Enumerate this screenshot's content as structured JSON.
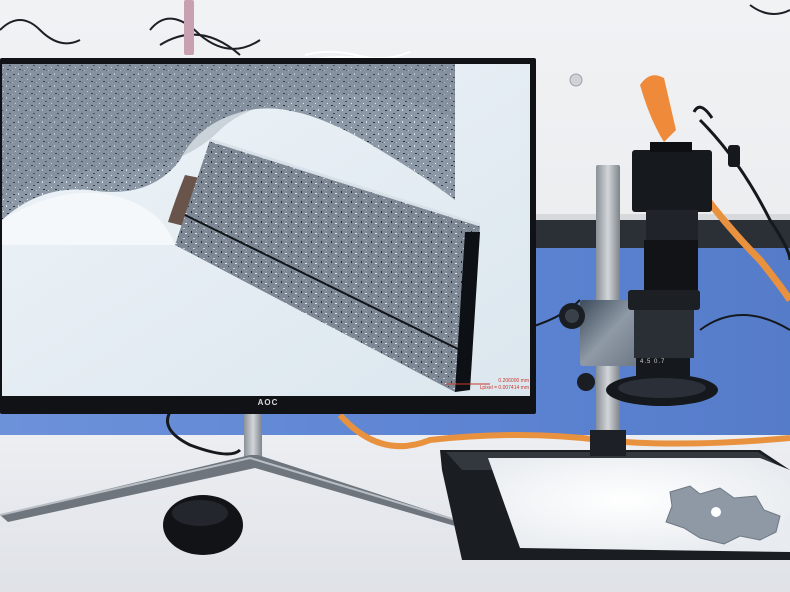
{
  "monitor": {
    "brand": "AOC",
    "measurement_line_1": "0.206000 mm",
    "measurement_line_2": "Lpixel = 0.007414 mm"
  },
  "microscope": {
    "lens_markings": "4.5  0.7"
  }
}
